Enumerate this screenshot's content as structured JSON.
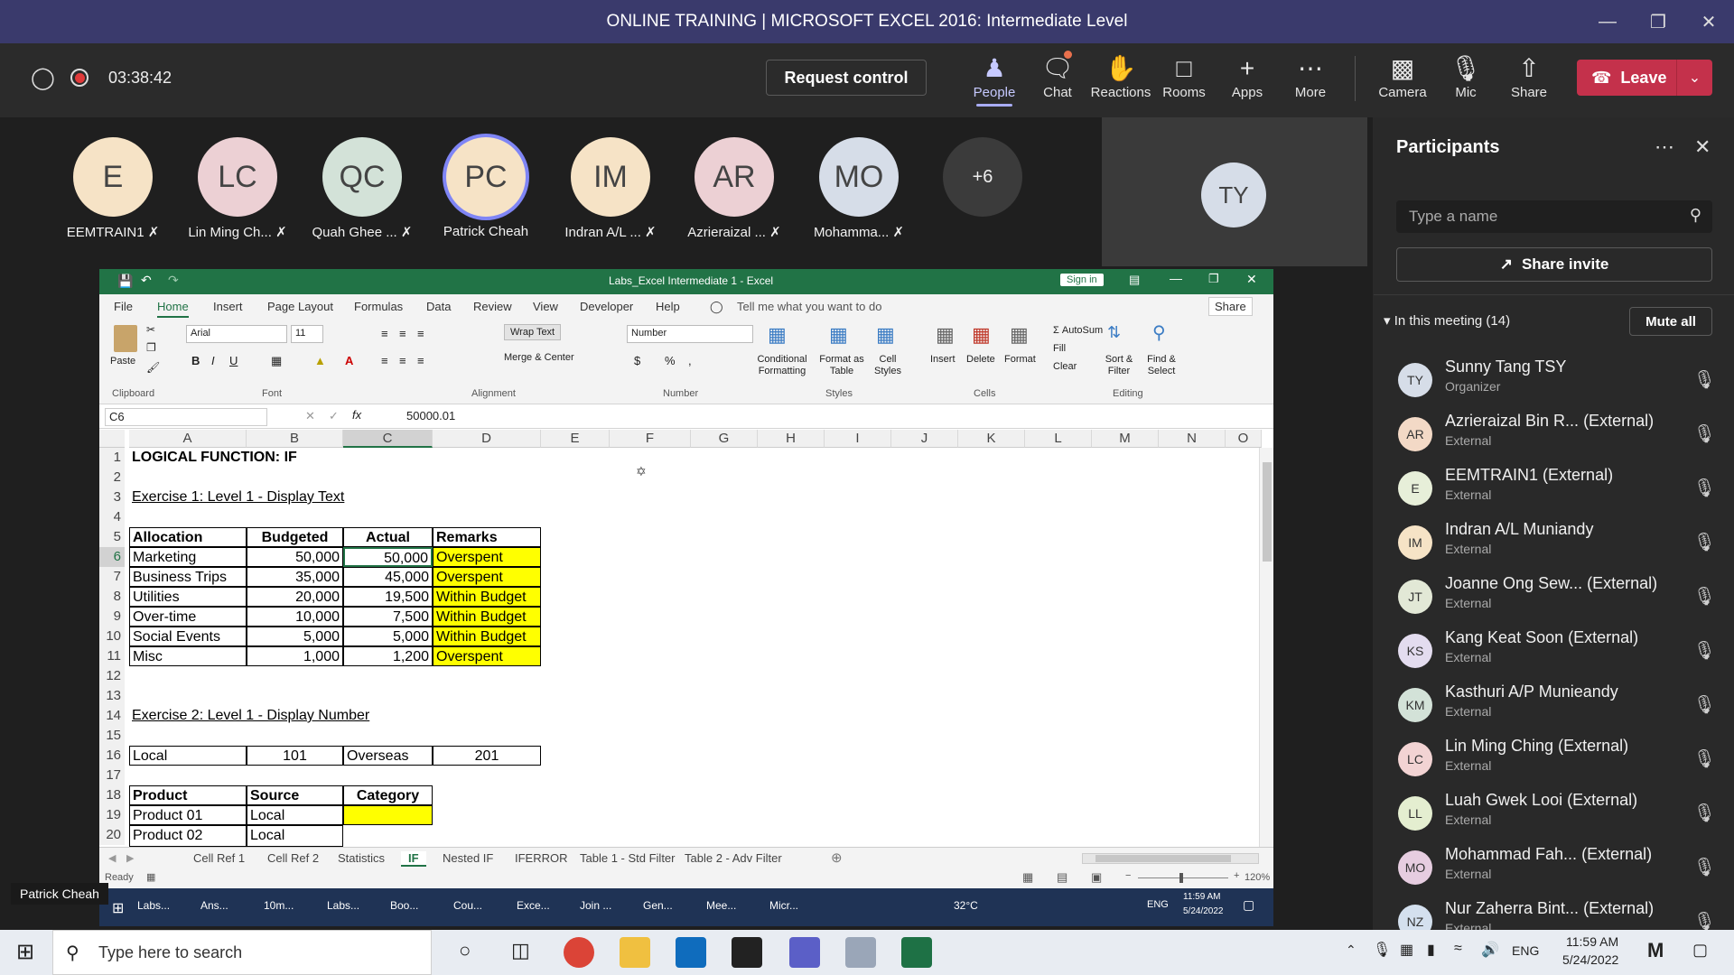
{
  "window": {
    "title": "ONLINE TRAINING | MICROSOFT EXCEL 2016: Intermediate Level"
  },
  "meeting": {
    "timer": "03:38:42",
    "request_control": "Request control",
    "toolbar": [
      {
        "label": "People",
        "icon": "people-icon"
      },
      {
        "label": "Chat",
        "icon": "chat-icon"
      },
      {
        "label": "Reactions",
        "icon": "reactions-icon"
      },
      {
        "label": "Rooms",
        "icon": "rooms-icon"
      },
      {
        "label": "Apps",
        "icon": "apps-icon"
      },
      {
        "label": "More",
        "icon": "more-icon"
      },
      {
        "label": "Camera",
        "icon": "camera-off-icon"
      },
      {
        "label": "Mic",
        "icon": "mic-off-icon"
      },
      {
        "label": "Share",
        "icon": "share-icon"
      }
    ],
    "leave": "Leave",
    "presenter_label": "Patrick Cheah"
  },
  "stage": {
    "avatars": [
      {
        "initials": "E",
        "name": "EEMTRAIN1",
        "color": "#f6e3c6"
      },
      {
        "initials": "LC",
        "name": "Lin Ming Ch...",
        "color": "#ecd0d4"
      },
      {
        "initials": "QC",
        "name": "Quah Ghee ...",
        "color": "#d3e2d8"
      },
      {
        "initials": "PC",
        "name": "Patrick Cheah",
        "color": "#f6e3c6"
      },
      {
        "initials": "IM",
        "name": "Indran A/L ...",
        "color": "#f6e3c6"
      },
      {
        "initials": "AR",
        "name": "Azrieraizal ...",
        "color": "#ecd0d4"
      },
      {
        "initials": "MO",
        "name": "Mohamma...",
        "color": "#d6dde8"
      }
    ],
    "more": "+6",
    "self_initials": "TY"
  },
  "panel": {
    "title": "Participants",
    "search_placeholder": "Type a name",
    "share_invite": "Share invite",
    "section": "In this meeting (14)",
    "mute_all": "Mute all",
    "people": [
      {
        "i": "TY",
        "n": "Sunny Tang TSY",
        "tag": "",
        "s": "Organizer"
      },
      {
        "i": "AR",
        "n": "Azrieraizal Bin R...",
        "tag": "(External)",
        "s": "External"
      },
      {
        "i": "E",
        "n": "EEMTRAIN1",
        "tag": "(External)",
        "s": "External"
      },
      {
        "i": "IM",
        "n": "Indran A/L Muniandy",
        "tag": "",
        "s": "External"
      },
      {
        "i": "JT",
        "n": "Joanne Ong Sew...",
        "tag": "(External)",
        "s": "External"
      },
      {
        "i": "KS",
        "n": "Kang Keat Soon",
        "tag": "(External)",
        "s": "External"
      },
      {
        "i": "KM",
        "n": "Kasthuri A/P Munieandy",
        "tag": "",
        "s": "External"
      },
      {
        "i": "LC",
        "n": "Lin Ming Ching",
        "tag": "(External)",
        "s": "External"
      },
      {
        "i": "LL",
        "n": "Luah Gwek Looi",
        "tag": "(External)",
        "s": "External"
      },
      {
        "i": "MO",
        "n": "Mohammad Fah...",
        "tag": "(External)",
        "s": "External"
      },
      {
        "i": "NZ",
        "n": "Nur Zaherra Bint...",
        "tag": "(External)",
        "s": "External"
      }
    ]
  },
  "excel": {
    "title": "Labs_Excel Intermediate 1 - Excel",
    "sign_in": "Sign in",
    "tabs": [
      "File",
      "Home",
      "Insert",
      "Page Layout",
      "Formulas",
      "Data",
      "Review",
      "View",
      "Developer",
      "Help"
    ],
    "tell_me": "Tell me what you want to do",
    "share": "Share",
    "font": "Arial",
    "font_size": "11",
    "wrap_text": "Wrap Text",
    "merge_center": "Merge & Center",
    "number_format": "Number",
    "autosum": "AutoSum",
    "fill": "Fill",
    "clear": "Clear",
    "buttons": {
      "paste": "Paste",
      "cond": "Conditional Formatting",
      "fmt_table": "Format as Table",
      "cell_styles": "Cell Styles",
      "insert": "Insert",
      "delete": "Delete",
      "format": "Format",
      "sort": "Sort & Filter",
      "find": "Find & Select"
    },
    "groups": [
      "Clipboard",
      "Font",
      "Alignment",
      "Number",
      "Styles",
      "Cells",
      "Editing"
    ],
    "name_box": "C6",
    "formula": "50000.01",
    "columns": [
      "A",
      "B",
      "C",
      "D",
      "E",
      "F",
      "G",
      "H",
      "I",
      "J",
      "K",
      "L",
      "M",
      "N",
      "O"
    ],
    "cells": {
      "r1": "LOGICAL FUNCTION: IF",
      "r3": "Exercise 1: Level 1 - Display Text",
      "hdr": [
        "Allocation",
        "Budgeted",
        "Actual",
        "Remarks"
      ],
      "rows": [
        [
          "Marketing",
          "50,000",
          "50,000",
          "Overspent"
        ],
        [
          "Business Trips",
          "35,000",
          "45,000",
          "Overspent"
        ],
        [
          "Utilities",
          "20,000",
          "19,500",
          "Within Budget"
        ],
        [
          "Over-time",
          "10,000",
          "7,500",
          "Within Budget"
        ],
        [
          "Social Events",
          "5,000",
          "5,000",
          "Within Budget"
        ],
        [
          "Misc",
          "1,000",
          "1,200",
          "Overspent"
        ]
      ],
      "r14": "Exercise 2: Level 1 - Display Number",
      "r16": [
        "Local",
        "101",
        "Overseas",
        "201"
      ],
      "r18": [
        "Product",
        "Source",
        "Category"
      ],
      "r19": [
        "Product 01",
        "Local"
      ],
      "r20": [
        "Product 02",
        "Local"
      ]
    },
    "sheet_tabs": [
      "Cell Ref 1",
      "Cell Ref 2",
      "Statistics",
      "IF",
      "Nested IF",
      "IFERROR",
      "Table 1 - Std Filter",
      "Table 2 - Adv Filter"
    ],
    "status": "Ready",
    "zoom": "120%",
    "inner_task": {
      "apps": [
        "Labs...",
        "Ans...",
        "10m...",
        "Labs...",
        "Boo...",
        "Cou...",
        "Exce...",
        "Join ...",
        "Gen...",
        "Mee...",
        "Micr..."
      ],
      "temp": "32°C",
      "lang": "ENG",
      "time": "11:59 AM",
      "date": "5/24/2022"
    }
  },
  "taskbar": {
    "search_placeholder": "Type here to search",
    "lang": "ENG",
    "time": "11:59 AM",
    "date": "5/24/2022"
  }
}
